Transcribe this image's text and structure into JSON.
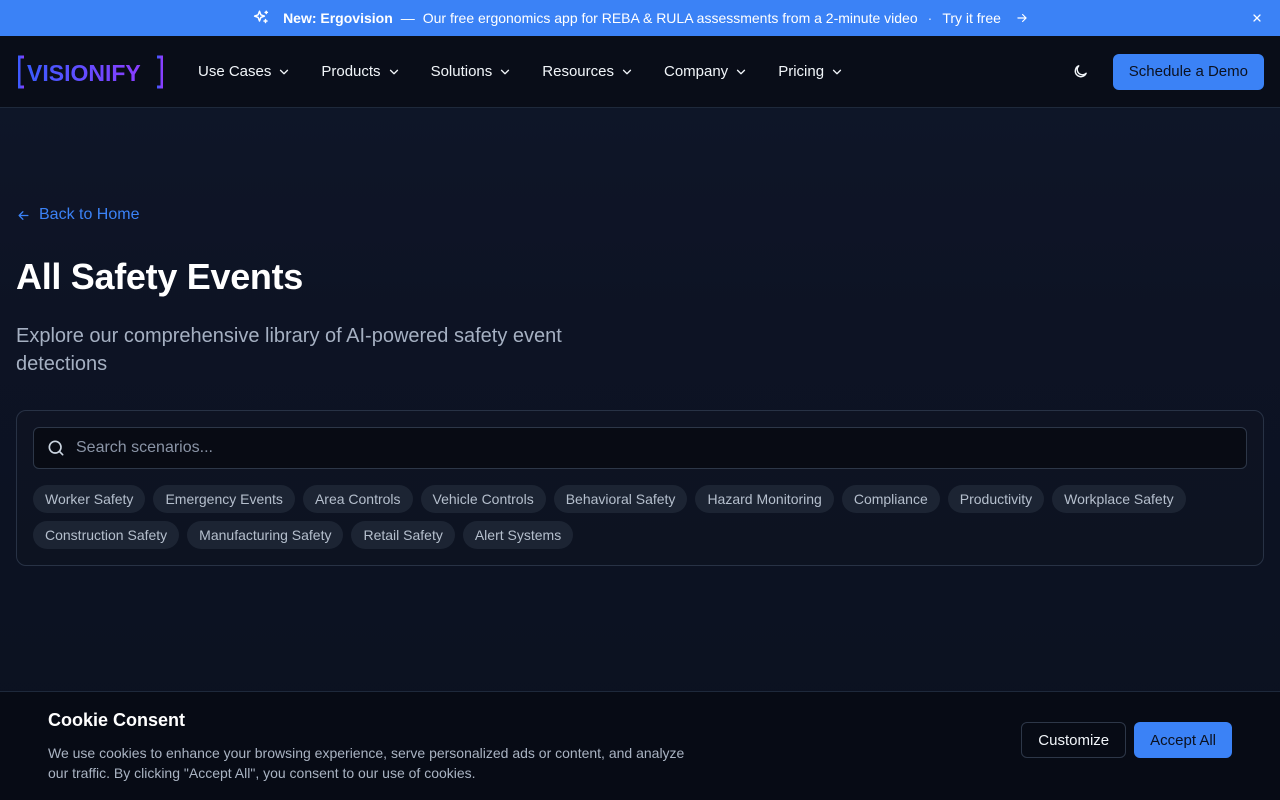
{
  "banner": {
    "new_label": "New: Ergovision",
    "dash": "—",
    "message": "Our free ergonomics app for REBA & RULA assessments from a 2-minute video",
    "separator": "·",
    "cta": "Try it free"
  },
  "nav": {
    "logo_text": "VISIONIFY",
    "items": [
      {
        "label": "Use Cases"
      },
      {
        "label": "Products"
      },
      {
        "label": "Solutions"
      },
      {
        "label": "Resources"
      },
      {
        "label": "Company"
      },
      {
        "label": "Pricing"
      }
    ],
    "demo_button": "Schedule a Demo"
  },
  "main": {
    "back_link": "Back to Home",
    "title": "All Safety Events",
    "subtitle": "Explore our comprehensive library of AI-powered safety event detections",
    "search_placeholder": "Search scenarios...",
    "chips": [
      "Worker Safety",
      "Emergency Events",
      "Area Controls",
      "Vehicle Controls",
      "Behavioral Safety",
      "Hazard Monitoring",
      "Compliance",
      "Productivity",
      "Workplace Safety",
      "Construction Safety",
      "Manufacturing Safety",
      "Retail Safety",
      "Alert Systems"
    ]
  },
  "cookie": {
    "title": "Cookie Consent",
    "body": "We use cookies to enhance your browsing experience, serve personalized ads or content, and analyze our traffic. By clicking \"Accept All\", you consent to our use of cookies.",
    "customize": "Customize",
    "accept": "Accept All"
  },
  "colors": {
    "accent": "#3b82f6",
    "logo_purple": "#7c3aed",
    "background": "#0b1120"
  },
  "icons": {
    "banner": "sparkles-icon",
    "banner_arrow": "arrow-right-icon",
    "banner_close": "close-icon",
    "nav_chevron": "chevron-down-icon",
    "theme": "moon-icon",
    "back": "arrow-left-icon",
    "search": "search-icon"
  }
}
